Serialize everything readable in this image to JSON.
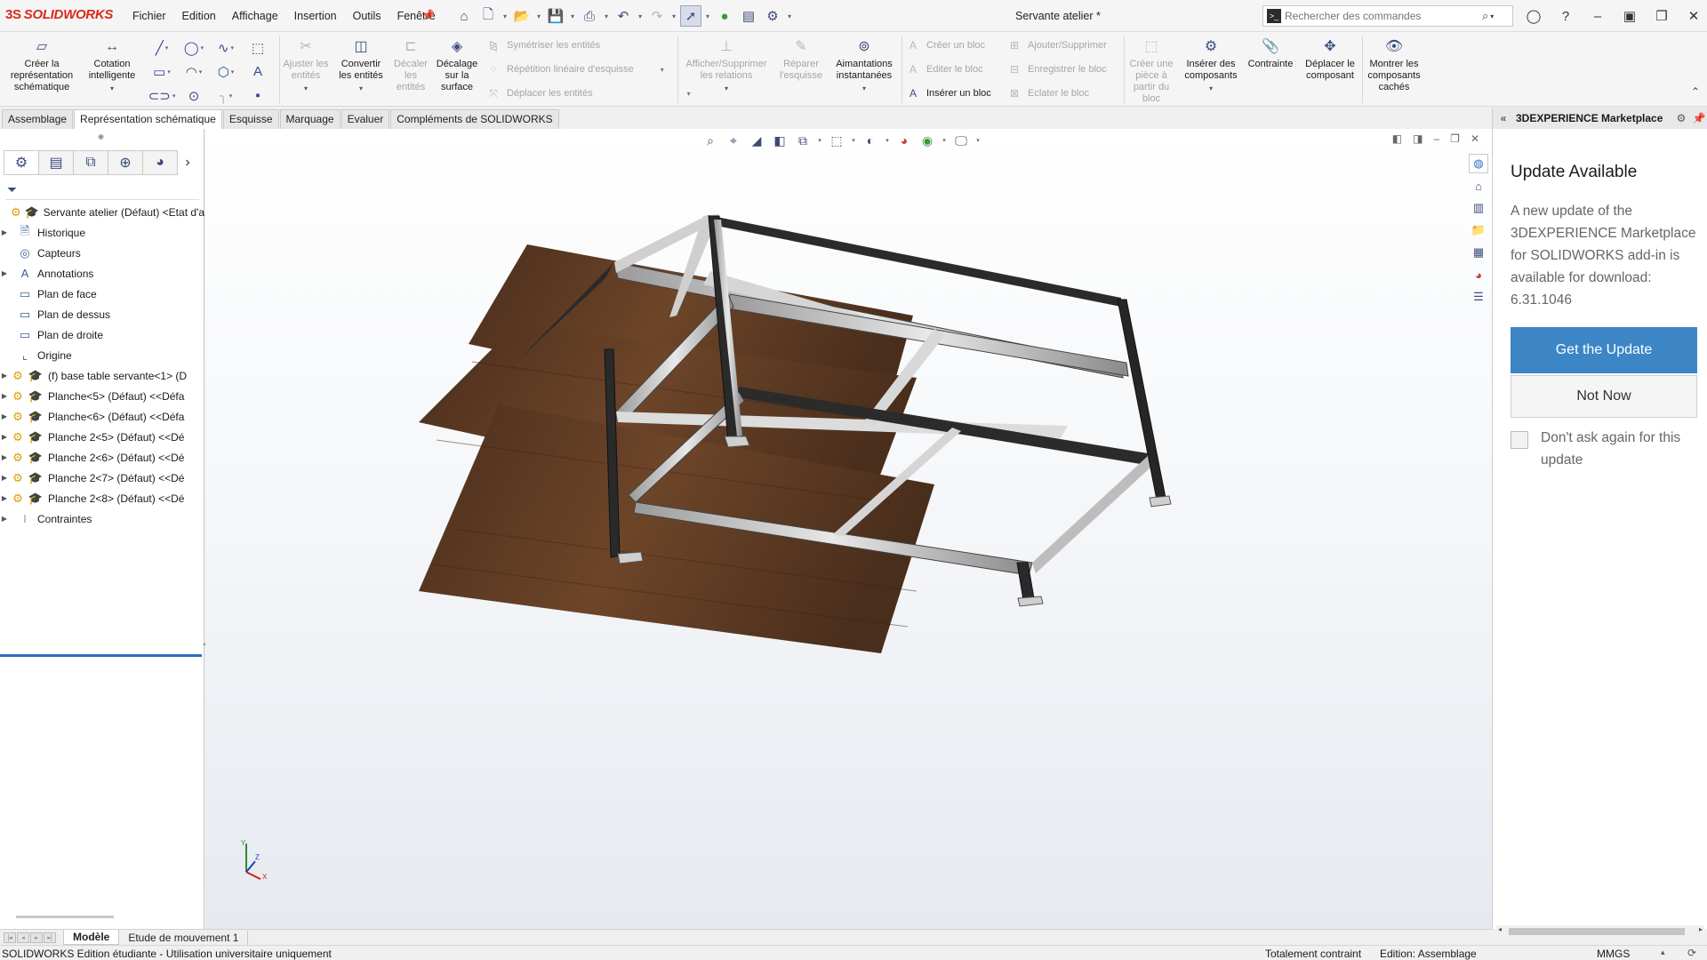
{
  "app": {
    "logo_prefix": "3S",
    "logo_text": "SOLIDWORKS",
    "document_title": "Servante atelier *"
  },
  "menu": [
    "Fichier",
    "Edition",
    "Affichage",
    "Insertion",
    "Outils",
    "Fenêtre"
  ],
  "search": {
    "placeholder": "Rechercher des commandes"
  },
  "ribbon": {
    "create_schematic": "Créer la représentation schématique",
    "smart_dimension": "Cotation intelligente",
    "trim": "Ajuster les entités",
    "convert": "Convertir les entités",
    "offset": "Décaler les entités",
    "offset_surface": "Décalage sur la surface",
    "mirror": "Symétriser les entités",
    "linear_pattern": "Répétition linéaire d'esquisse",
    "move": "Déplacer les entités",
    "relations": "Afficher/Supprimer les relations",
    "repair": "Réparer l'esquisse",
    "snaps": "Aimantations instantanées",
    "make_block": "Créer un bloc",
    "edit_block": "Editer le bloc",
    "insert_block": "Insérer un bloc",
    "add_remove": "Ajouter/Supprimer",
    "save_block": "Enregistrer le bloc",
    "explode_block": "Eclater le bloc",
    "create_part": "Créer une pièce à partir du bloc",
    "insert_components": "Insérer des composants",
    "constraint": "Contrainte",
    "move_component": "Déplacer le composant",
    "show_hidden": "Montrer les composants cachés"
  },
  "tabs": [
    "Assemblage",
    "Représentation schématique",
    "Esquisse",
    "Marquage",
    "Evaluer",
    "Compléments de SOLIDWORKS"
  ],
  "active_tab": "Représentation schématique",
  "tree": [
    {
      "label": "Servante atelier (Défaut) <Etat d'a",
      "expand": "",
      "type": "root"
    },
    {
      "label": "Historique",
      "expand": "▶",
      "type": "folder"
    },
    {
      "label": "Capteurs",
      "expand": "",
      "type": "sensor"
    },
    {
      "label": "Annotations",
      "expand": "▶",
      "type": "annotation"
    },
    {
      "label": "Plan de face",
      "expand": "",
      "type": "plane"
    },
    {
      "label": "Plan de dessus",
      "expand": "",
      "type": "plane"
    },
    {
      "label": "Plan de droite",
      "expand": "",
      "type": "plane"
    },
    {
      "label": "Origine",
      "expand": "",
      "type": "origin"
    },
    {
      "label": "(f) base table servante<1> (D",
      "expand": "▶",
      "type": "part"
    },
    {
      "label": "Planche<5> (Défaut) <<Défa",
      "expand": "▶",
      "type": "part"
    },
    {
      "label": "Planche<6> (Défaut) <<Défa",
      "expand": "▶",
      "type": "part"
    },
    {
      "label": "Planche 2<5> (Défaut) <<Dé",
      "expand": "▶",
      "type": "part"
    },
    {
      "label": "Planche 2<6> (Défaut) <<Dé",
      "expand": "▶",
      "type": "part"
    },
    {
      "label": "Planche 2<7> (Défaut) <<Dé",
      "expand": "▶",
      "type": "part"
    },
    {
      "label": "Planche 2<8> (Défaut) <<Dé",
      "expand": "▶",
      "type": "part"
    },
    {
      "label": "Contraintes",
      "expand": "▶",
      "type": "mates"
    }
  ],
  "taskpane": {
    "header": "3DEXPERIENCE Marketplace",
    "update_title": "Update Available",
    "update_text": "A new update of the 3DEXPERIENCE Marketplace for SOLIDWORKS add-in is available for download: 6.31.1046",
    "get_update": "Get the Update",
    "not_now": "Not Now",
    "dont_ask": "Don't ask again for this update"
  },
  "bottom_tabs": [
    "Modèle",
    "Etude de mouvement 1"
  ],
  "status": {
    "left": "SOLIDWORKS Edition étudiante - Utilisation universitaire uniquement",
    "constraint": "Totalement contraint",
    "edit_mode": "Edition: Assemblage",
    "units": "MMGS"
  },
  "colors": {
    "accent_blue": "#3d86c6",
    "brand_red": "#da291c",
    "wood": "#5a3a24",
    "steel": "#2b2b2b"
  }
}
